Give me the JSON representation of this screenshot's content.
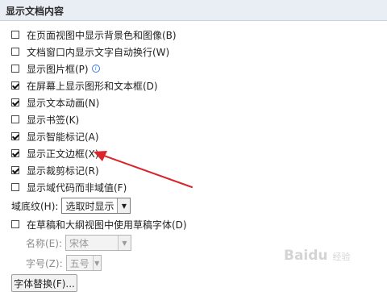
{
  "section": {
    "title": "显示文档内容"
  },
  "options": [
    {
      "label": "在页面视图中显示背景色和图像(B)",
      "checked": false
    },
    {
      "label": "文档窗口内显示文字自动换行(W)",
      "checked": false
    },
    {
      "label": "显示图片框(P)",
      "checked": false
    },
    {
      "label": "在屏幕上显示图形和文本框(D)",
      "checked": true
    },
    {
      "label": "显示文本动画(N)",
      "checked": true
    },
    {
      "label": "显示书签(K)",
      "checked": false
    },
    {
      "label": "显示智能标记(A)",
      "checked": true
    },
    {
      "label": "显示正文边框(X)",
      "checked": true
    },
    {
      "label": "显示裁剪标记(R)",
      "checked": true
    },
    {
      "label": "显示域代码而非域值(F)",
      "checked": false
    }
  ],
  "field_shading": {
    "label": "域底纹(H):",
    "value": "选取时显示"
  },
  "draft_font": {
    "label": "在草稿和大纲视图中使用草稿字体(D)",
    "checked": false
  },
  "font_name": {
    "label": "名称(E):",
    "value": "宋体"
  },
  "font_size": {
    "label": "字号(Z):",
    "value": "五号"
  },
  "substitution_button": {
    "label": "字体替换(F)..."
  },
  "watermark": {
    "brand": "Baidu",
    "sub": "经验"
  },
  "colors": {
    "arrow": "#d9262b",
    "header_bg": "#e9eef5"
  }
}
